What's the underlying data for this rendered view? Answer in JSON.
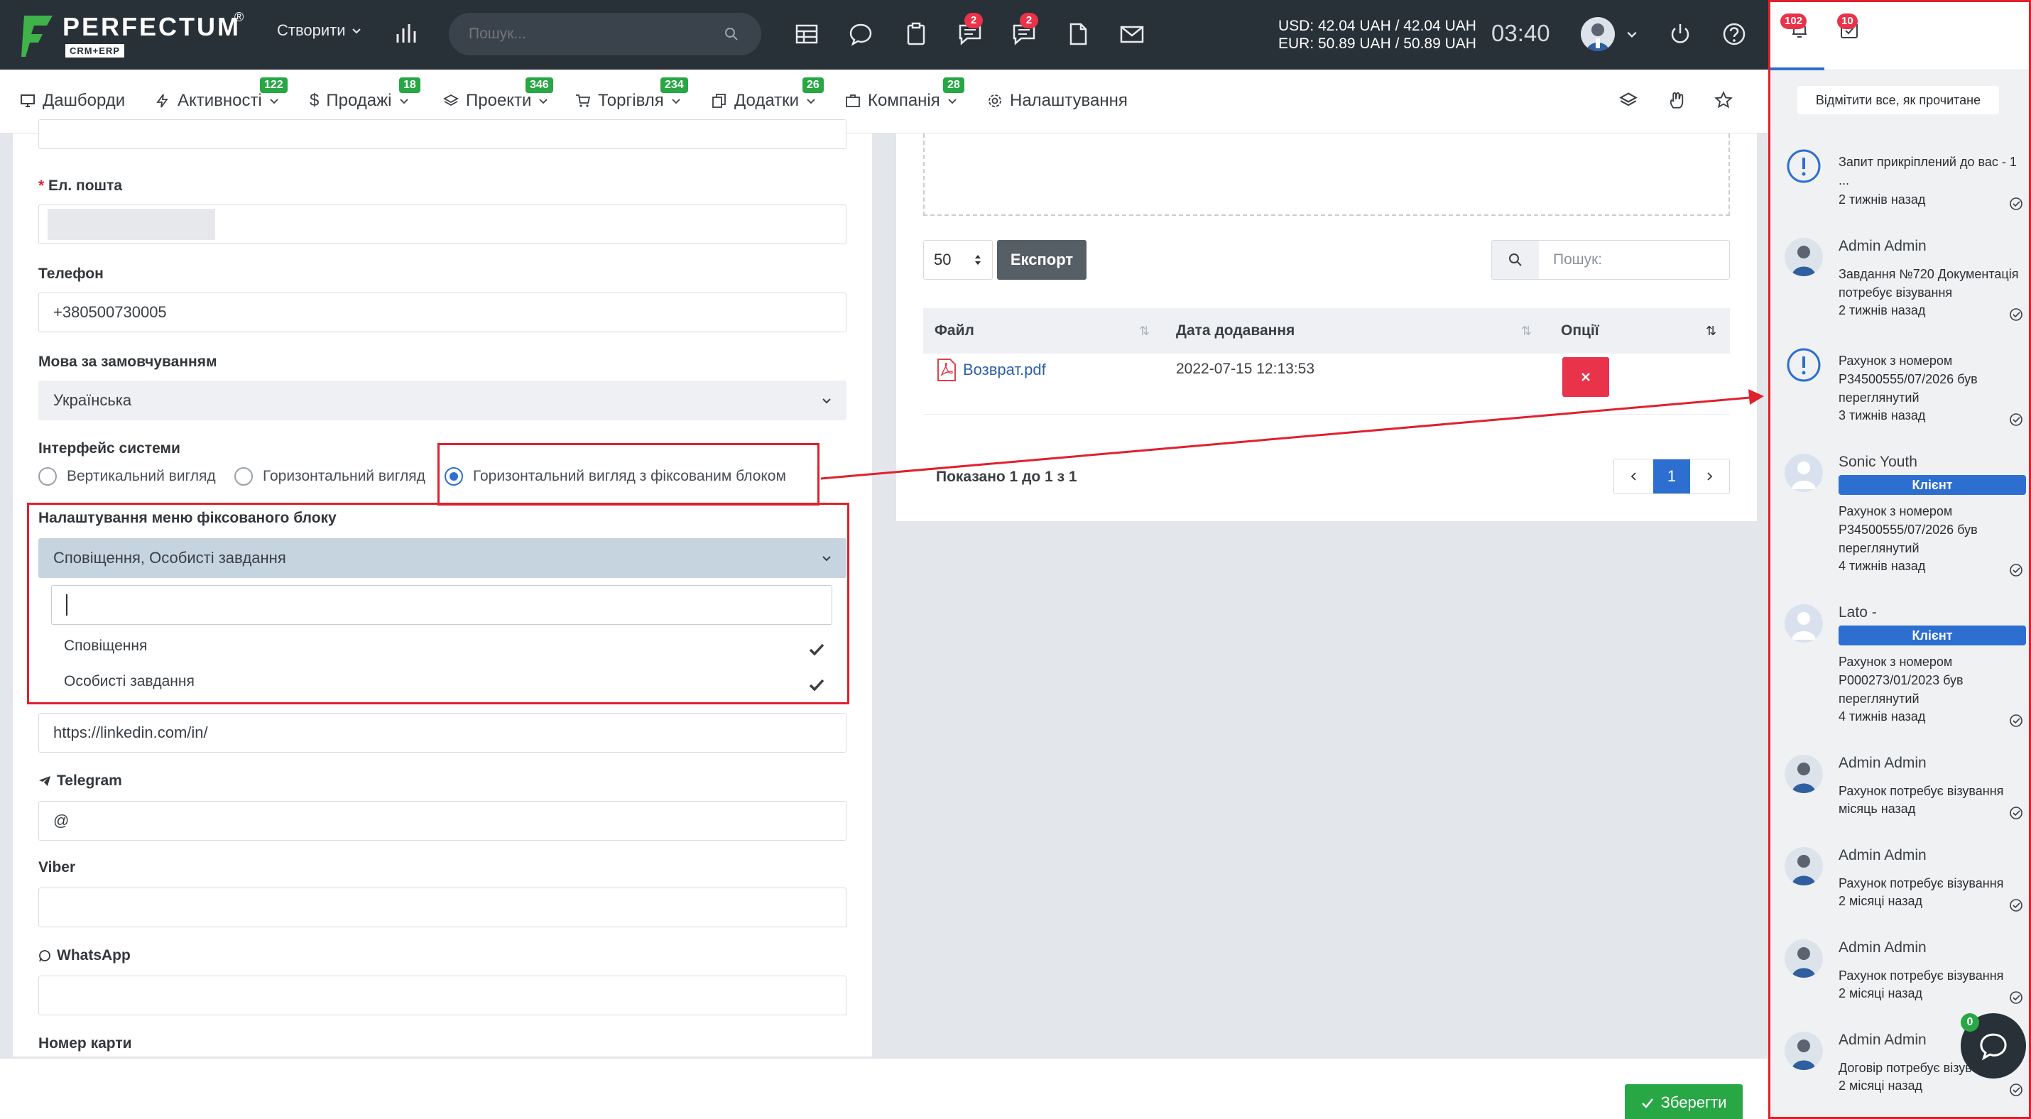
{
  "header": {
    "logo_text": "PERFECTUM",
    "logo_reg": "®",
    "logo_sub": "CRM+ERP",
    "create_label": "Створити",
    "search_placeholder": "Пошук...",
    "chat_badge": "2",
    "messages_badge": "2",
    "usd_rate": "USD: 42.04 UAH / 42.04 UAH",
    "eur_rate": "EUR: 50.89 UAH / 50.89 UAH",
    "clock": "03:40"
  },
  "nav": [
    {
      "label": "Дашборди",
      "badge": ""
    },
    {
      "label": "Активності",
      "badge": "122"
    },
    {
      "label": "Продажі",
      "badge": "18"
    },
    {
      "label": "Проекти",
      "badge": "346"
    },
    {
      "label": "Торгівля",
      "badge": "234"
    },
    {
      "label": "Додатки",
      "badge": "26"
    },
    {
      "label": "Компанія",
      "badge": "28"
    },
    {
      "label": "Налаштування",
      "badge": ""
    }
  ],
  "form": {
    "email_label": "Ел. пошта",
    "email_required": "*",
    "phone_label": "Телефон",
    "phone_value": "+380500730005",
    "lang_label": "Мова за замовчуванням",
    "lang_value": "Українська",
    "ui_label": "Інтерфейс системи",
    "ui_options": [
      "Вертикальний вигляд",
      "Горизонтальний вигляд",
      "Горизонтальний вигляд з фіксованим блоком"
    ],
    "fixed_menu_label": "Налаштування меню фіксованого блоку",
    "fixed_menu_value": "Сповіщення, Особисті завдання",
    "fixed_menu_options": [
      "Сповіщення",
      "Особисті завдання"
    ],
    "linkedin_value": "https://linkedin.com/in/",
    "telegram_label": "Telegram",
    "telegram_value": "@",
    "viber_label": "Viber",
    "whatsapp_label": "WhatsApp",
    "card_label": "Номер карти"
  },
  "files": {
    "page_size": "50",
    "export_label": "Експорт",
    "search_label": "Пошук:",
    "columns": [
      "Файл",
      "Дата додавання",
      "Опції"
    ],
    "rows": [
      {
        "file": "Возврат.pdf",
        "date": "2022-07-15 12:13:53"
      }
    ],
    "info": "Показано 1 до 1 з 1",
    "page": "1"
  },
  "save_label": "Зберегти",
  "notifications": {
    "tab1_badge": "102",
    "tab2_badge": "10",
    "mark_all_label": "Відмітити все, як прочитане",
    "chat_badge": "0",
    "items": [
      {
        "name": "",
        "tag": "",
        "message": "Запит прикріплений до вас - 1 ...",
        "time": "2 тижнів назад"
      },
      {
        "name": "Admin Admin",
        "tag": "",
        "message": "Завдання №720 Документація потребує візування",
        "time": "2 тижнів назад"
      },
      {
        "name": "",
        "tag": "",
        "message": "Рахунок з номером P34500555/07/2026 був переглянутий",
        "time": "3 тижнів назад"
      },
      {
        "name": "Sonic Youth",
        "tag": "Клієнт",
        "message": "Рахунок з номером P34500555/07/2026 був переглянутий",
        "time": "4 тижнів назад"
      },
      {
        "name": "Lato -",
        "tag": "Клієнт",
        "message": "Рахунок з номером P000273/01/2023 був переглянутий",
        "time": "4 тижнів назад"
      },
      {
        "name": "Admin Admin",
        "tag": "",
        "message": "Рахунок потребує візування",
        "time": "місяць назад"
      },
      {
        "name": "Admin Admin",
        "tag": "",
        "message": "Рахунок потребує візування",
        "time": "2 місяці назад"
      },
      {
        "name": "Admin Admin",
        "tag": "",
        "message": "Рахунок потребує візування",
        "time": "2 місяці назад"
      },
      {
        "name": "Admin Admin",
        "tag": "",
        "message": "Договір потребує візув...",
        "time": "2 місяці назад"
      }
    ]
  }
}
